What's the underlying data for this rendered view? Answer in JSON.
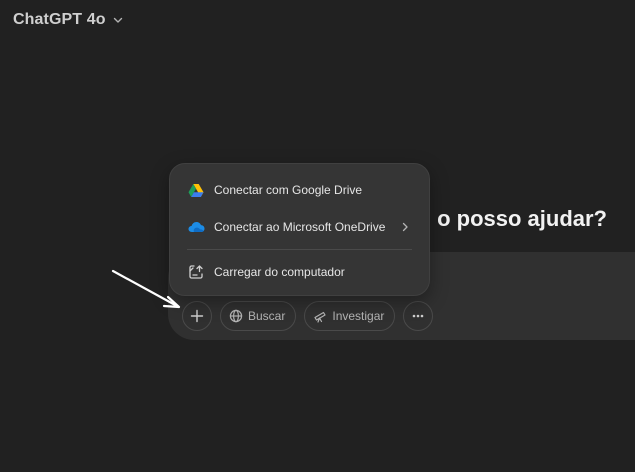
{
  "header": {
    "model_label": "ChatGPT 4o",
    "model_chevron_icon": "chevron-down-icon"
  },
  "main": {
    "headline_visible": "o posso ajudar?"
  },
  "attach_menu": {
    "items": [
      {
        "label": "Conectar com Google Drive",
        "icon": "google-drive-icon",
        "has_submenu": false
      },
      {
        "label": "Conectar ao Microsoft OneDrive",
        "icon": "onedrive-icon",
        "has_submenu": true
      },
      {
        "label": "Carregar do computador",
        "icon": "upload-file-icon",
        "has_submenu": false
      }
    ]
  },
  "composer": {
    "add_icon": "plus-icon",
    "search_label": "Buscar",
    "search_icon": "globe-icon",
    "research_label": "Investigar",
    "research_icon": "telescope-icon",
    "more_icon": "more-horizontal-icon"
  },
  "colors": {
    "background": "#212121",
    "composer": "#303030",
    "menu": "#353535",
    "text": "#ececec",
    "annotation_arrow": "#ffffff"
  }
}
